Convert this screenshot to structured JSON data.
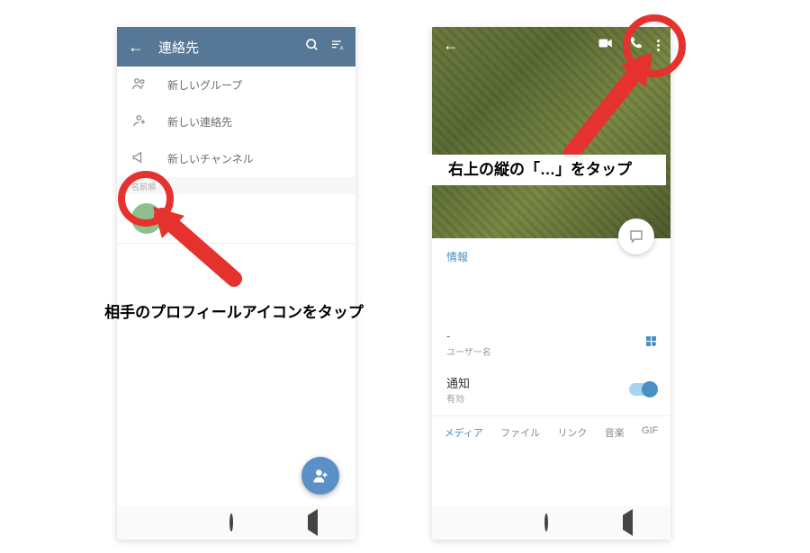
{
  "left": {
    "header": {
      "title": "連絡先"
    },
    "menu": {
      "newGroup": "新しいグループ",
      "newContact": "新しい連絡先",
      "newChannel": "新しいチャンネル"
    },
    "sortLabel": "名前順"
  },
  "right": {
    "infoTab": "情報",
    "usernameDash": "-",
    "usernameLabel": "ユーザー名",
    "notifLabel": "通知",
    "notifValue": "有効",
    "tabs": {
      "media": "メディア",
      "file": "ファイル",
      "link": "リンク",
      "music": "音楽",
      "gif": "GIF"
    }
  },
  "captions": {
    "left": "相手のプロフィールアイコンをタップ",
    "right": "右上の縦の「…」をタップ"
  }
}
